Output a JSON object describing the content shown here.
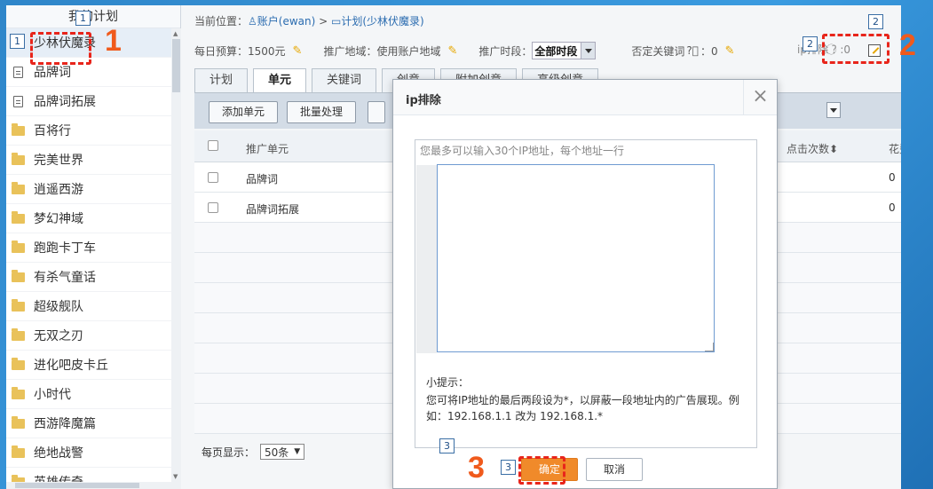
{
  "sidebar": {
    "title": "我的计划",
    "items": [
      {
        "label": "少林伏魔录",
        "type": "doc",
        "active": true
      },
      {
        "label": "品牌词",
        "type": "doc"
      },
      {
        "label": "品牌词拓展",
        "type": "doc"
      },
      {
        "label": "百将行",
        "type": "folder"
      },
      {
        "label": "完美世界",
        "type": "folder"
      },
      {
        "label": "逍遥西游",
        "type": "folder"
      },
      {
        "label": "梦幻神域",
        "type": "folder"
      },
      {
        "label": "跑跑卡丁车",
        "type": "folder"
      },
      {
        "label": "有杀气童话",
        "type": "folder"
      },
      {
        "label": "超级舰队",
        "type": "folder"
      },
      {
        "label": "无双之刃",
        "type": "folder"
      },
      {
        "label": "进化吧皮卡丘",
        "type": "folder"
      },
      {
        "label": "小时代",
        "type": "folder"
      },
      {
        "label": "西游降魔篇",
        "type": "folder"
      },
      {
        "label": "绝地战警",
        "type": "folder"
      },
      {
        "label": "英雄传奇",
        "type": "folder"
      }
    ]
  },
  "breadcrumb": {
    "prefix": "当前位置：",
    "account": "账户(ewan)",
    "separator": " > ",
    "plan": "计划(少林伏魔录)"
  },
  "infobar": {
    "budget": "每日预算：1500元",
    "region": "推广地域：使用账户地域",
    "period_label": "推广时段：",
    "period_value": "全部时段",
    "negative_kw": "否定关键词",
    "negative_kw_count": "：0",
    "ip_label": "ip排除",
    "ip_count": ":0"
  },
  "tabs": [
    "计划",
    "单元",
    "关键词",
    "创意",
    "附加创意",
    "高级创意"
  ],
  "toolbar": {
    "add_unit": "添加单元",
    "batch": "批量处理"
  },
  "table": {
    "col_unit": "推广单元",
    "col_clicks": "点击次数",
    "col_cost": "花费",
    "rows": [
      {
        "name": "品牌词",
        "clicks": "0"
      },
      {
        "name": "品牌词拓展",
        "clicks": "0"
      }
    ]
  },
  "pager": {
    "label": "每页显示：",
    "value": "50条"
  },
  "modal": {
    "title": "ip排除",
    "close": "×",
    "hint": "您最多可以输入30个IP地址，每个地址一行",
    "tip_title": "小提示：",
    "tip_text": "您可将IP地址的最后两段设为*，以屏蔽一段地址内的广告展现。例如：192.168.1.1 改为 192.168.1.*",
    "ok": "确定",
    "cancel": "取消"
  },
  "annotations": {
    "badge1": "1",
    "badge2": "2",
    "badge3": "3",
    "step1": "1",
    "step2": "2",
    "step3": "3"
  },
  "colors": {
    "accent_orange": "#f08a2a",
    "annotation_red": "#e8251b",
    "link_blue": "#2b6cb0"
  }
}
